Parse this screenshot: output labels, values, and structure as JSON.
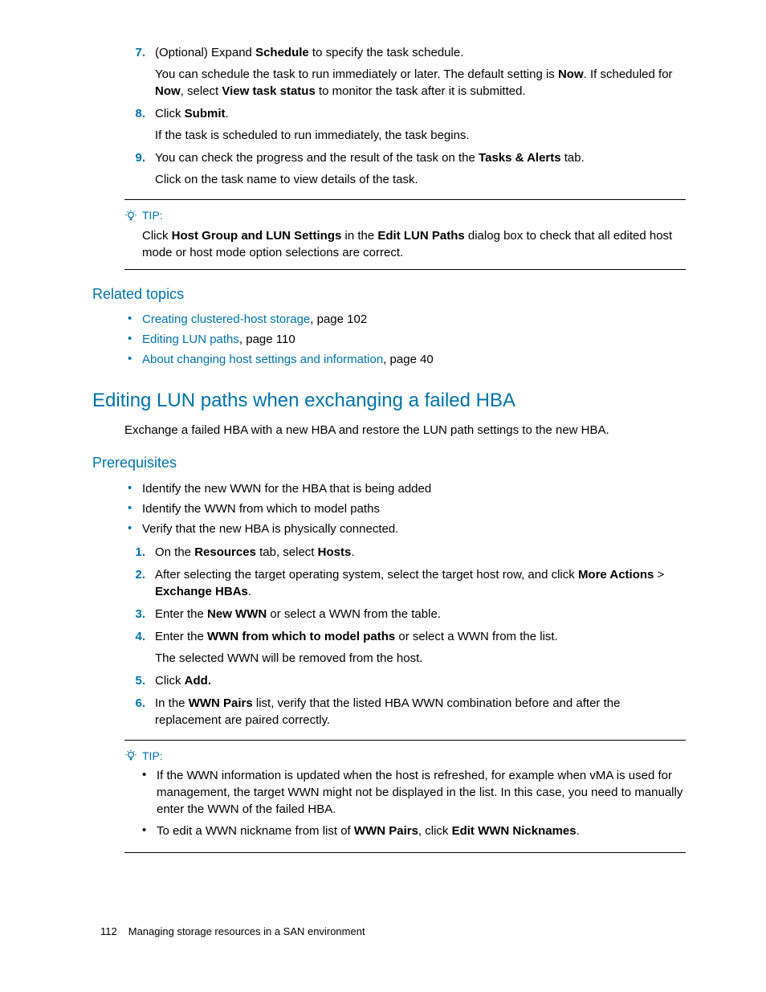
{
  "steps_a": {
    "7": {
      "num": "7.",
      "text_pre": "(Optional) Expand ",
      "b1": "Schedule",
      "text_post": " to specify the task schedule.",
      "sub_pre": "You can schedule the task to run immediately or later. The default setting is ",
      "sub_b1": "Now",
      "sub_mid": ". If scheduled for ",
      "sub_b2": "Now",
      "sub_mid2": ", select ",
      "sub_b3": "View task status",
      "sub_post": " to monitor the task after it is submitted."
    },
    "8": {
      "num": "8.",
      "text_pre": "Click ",
      "b1": "Submit",
      "text_post": ".",
      "sub": "If the task is scheduled to run immediately, the task begins."
    },
    "9": {
      "num": "9.",
      "text_pre": "You can check the progress and the result of the task on the ",
      "b1": "Tasks & Alerts",
      "text_post": " tab.",
      "sub": "Click on the task name to view details of the task."
    }
  },
  "tip1": {
    "label": "TIP:",
    "pre": "Click ",
    "b1": "Host Group and LUN Settings",
    "mid": " in the ",
    "b2": "Edit LUN Paths",
    "post": " dialog box to check that all edited host mode or host mode option selections are correct."
  },
  "related": {
    "heading": "Related topics",
    "items": [
      {
        "link": "Creating clustered-host storage",
        "suffix": ", page 102"
      },
      {
        "link": "Editing LUN paths",
        "suffix": ", page 110"
      },
      {
        "link": "About changing host settings and information",
        "suffix": ", page 40"
      }
    ]
  },
  "section2": {
    "heading": "Editing LUN paths when exchanging a failed HBA",
    "intro": "Exchange a failed HBA with a new HBA and restore the LUN path settings to the new HBA."
  },
  "prereq": {
    "heading": "Prerequisites",
    "bullets": [
      "Identify the new WWN for the HBA that is being added",
      "Identify the WWN from which to model paths",
      "Verify that the new HBA is physically connected."
    ]
  },
  "steps_b": {
    "1": {
      "num": "1.",
      "pre": "On the ",
      "b1": "Resources",
      "mid": " tab, select ",
      "b2": "Hosts",
      "post": "."
    },
    "2": {
      "num": "2.",
      "pre": "After selecting the target operating system, select the target host row, and click ",
      "b1": "More Actions",
      "mid": " > ",
      "b2": "Exchange HBAs",
      "post": "."
    },
    "3": {
      "num": "3.",
      "pre": "Enter the ",
      "b1": "New WWN",
      "post": " or select a WWN from the table."
    },
    "4": {
      "num": "4.",
      "pre": "Enter the ",
      "b1": "WWN from which to model paths",
      "post": " or select a WWN from the list.",
      "sub": "The selected WWN will be removed from the host."
    },
    "5": {
      "num": "5.",
      "pre": "Click ",
      "b1": "Add.",
      "post": ""
    },
    "6": {
      "num": "6.",
      "pre": "In the ",
      "b1": "WWN Pairs",
      "post": " list, verify that the listed HBA WWN combination before and after the replacement are paired correctly."
    }
  },
  "tip2": {
    "label": "TIP:",
    "b1": "If the WWN information is updated when the host is refreshed, for example when vMA is used for management, the target WWN might not be displayed in the list. In this case, you need to manually enter the WWN of the failed HBA.",
    "b2_pre": "To edit a WWN nickname from list of ",
    "b2_b1": "WWN Pairs",
    "b2_mid": ", click ",
    "b2_b2": "Edit WWN Nicknames",
    "b2_post": "."
  },
  "footer": {
    "page": "112",
    "title": "Managing storage resources in a SAN environment"
  }
}
